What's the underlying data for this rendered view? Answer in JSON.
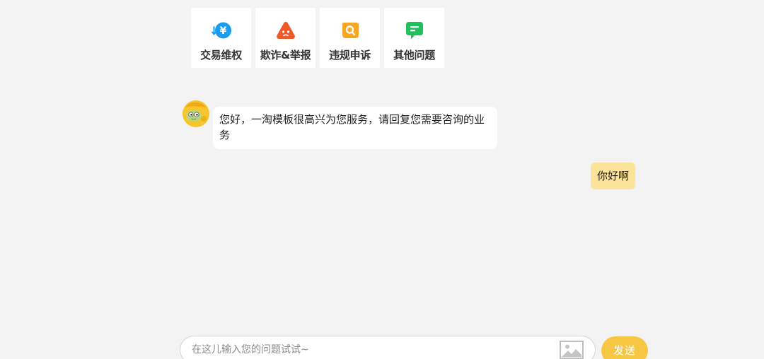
{
  "quick_menu": [
    {
      "label": "交易维权",
      "icon": "yuan-refund-icon",
      "color": "#1a9cf0"
    },
    {
      "label": "欺诈&举报",
      "icon": "warning-triangle-icon",
      "color": "#f05a28"
    },
    {
      "label": "违规申诉",
      "icon": "search-magnifier-icon",
      "color": "#f5a623"
    },
    {
      "label": "其他问题",
      "icon": "note-icon",
      "color": "#20c05c"
    }
  ],
  "messages": {
    "bot_greeting": "您好，一淘模板很高兴为您服务，请回复您需要咨询的业务",
    "user_message": "你好啊"
  },
  "input": {
    "placeholder": "在这儿输入您的问题试试~",
    "value": ""
  },
  "send_label": "发送",
  "colors": {
    "background": "#f3f3f3",
    "accent": "#f7c744",
    "user_bubble": "#fbe39a"
  }
}
